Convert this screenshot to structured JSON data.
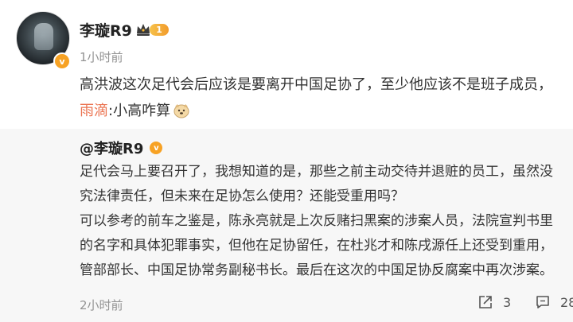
{
  "comment": {
    "author": "李璇R9",
    "level": "1",
    "time": "1小时前",
    "text": "高洪波这次足代会后应该是要离开中国足协了，至少他应该不是班子成员，",
    "reply_name": "雨滴",
    "reply_text": ":小高咋算"
  },
  "quoted_post": {
    "mention": "@李璇R9",
    "lines": [
      "足代会马上要召开了，我想知道的是，那些之前主动交待并退赃的员工，虽然没",
      "究法律责任，但未来在足协怎么使用？还能受重用吗？",
      "可以参考的前车之鉴是，陈永亮就是上次反赌扫黑案的涉案人员，法院宣判书里",
      "的名字和具体犯罪事实，但他在足协留任，在杜兆才和陈戌源任上还受到重用，",
      "管部部长、中国足协常务副秘书长。最后在这次的中国足协反腐案中再次涉案。"
    ],
    "time": "2小时前",
    "share_count": "3",
    "comment_count": "28"
  },
  "colors": {
    "reply_name": "#eb7350",
    "verified_badge": "#f7a224",
    "muted_text": "#939393",
    "quote_background": "#f7f7f7"
  },
  "icons": {
    "verified": "orange-v-badge",
    "member": "crown-icon",
    "emoji": "dog-face-emoji",
    "share": "share-icon",
    "comment": "comment-icon"
  }
}
